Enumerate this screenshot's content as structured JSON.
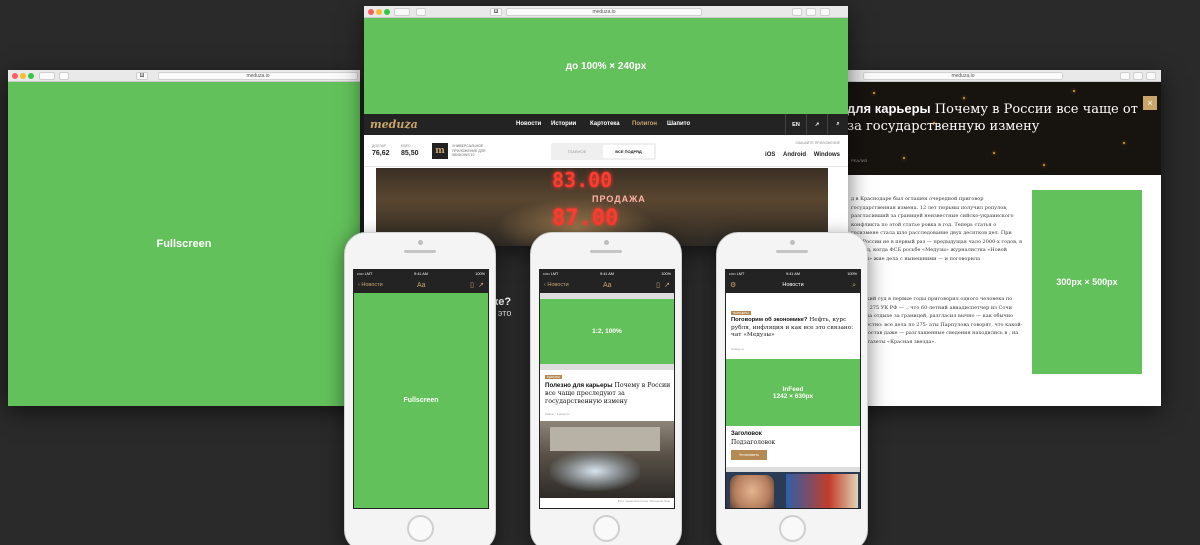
{
  "browser": {
    "url": "meduza.io",
    "tab_badge": "Ш"
  },
  "left_window": {
    "placement_label": "Fullscreen"
  },
  "center_window": {
    "top_banner_label": "до 100% × 240px",
    "logo": "meduza",
    "nav_items": [
      "Новости",
      "Истории",
      "Картотека",
      "Полигон",
      "Шапито"
    ],
    "nav_active": "Полигон",
    "lang": "EN",
    "ticker": {
      "usd_label": "Доллар",
      "usd_value": "76,62",
      "eur_label": "Евро",
      "eur_value": "85,50",
      "app_text": "Универсальное приложение для Windows 10",
      "seg_main": "Главное",
      "seg_all": "Все подряд",
      "download_label": "Скачайте приложение",
      "platforms": [
        "iOS",
        "Android",
        "Windows"
      ]
    },
    "photo_led_1": "83.00",
    "photo_sign": "ПРОДАЖА",
    "photo_led_2": "87.00",
    "photo_fragment_1": "ике?",
    "photo_fragment_2": "уе это"
  },
  "right_window": {
    "hero_title_bold": "для карьеры",
    "hero_title_rest": "Почему в России все чаще от за государственную измену",
    "hero_meta": "РЕАЛИЗ",
    "close": "×",
    "paragraph_1": "д в Краснодаре был оглашен очередной приговор государственная измена. 12 лет тюрьмы получил ропулов, разгласивший за границей неизвестные сийско-украинского конфликта по этой статье ровка в год. Теперь статья о госизмене стала шло расследование двух десятков дел. При ыла России не в первый раз — предыдущая чало 2000-х годов, в период, когда ФСБ росьбе «Медузы» журналистка «Новой газеты» жие дела с нынешними — и поговорила",
    "paragraph_2": "ндарский суд в первые годы приговорил одного человека по статье 275 УК РФ — ., что 60-летний авиадиспетчер из Сочи Петр на отдыхе за границей, разгласил вычно — как обычно неизвестно: все дела по 275- аты Парпулова говорят, что какой-либо состав даже — разглашенные сведения находились в , на сайте газеты «Красная звезда».",
    "ad_label": "300px × 500px"
  },
  "phones": {
    "status_left": "••••• LMT",
    "status_time": "9:41 AM",
    "status_right": "100%",
    "phone1": {
      "back": "Новости",
      "aa": "Aa",
      "placement_label": "Fullscreen"
    },
    "phone2": {
      "back": "Новости",
      "aa": "Aa",
      "ad_label": "1:2, 100%",
      "tag": "Реклама",
      "title_bold": "Полезно для карьеры",
      "title_rest": "Почему в России все чаще преследуют за государственную измену",
      "meta": "Рейсы  ·  3 минуты",
      "credit": "Фото: Анастасия Скляр / Вечерняя Лоха"
    },
    "phone3": {
      "title": "Новости",
      "tag": "Партнеры",
      "article_bold": "Поговорим об экономике?",
      "article_rest": "Нефть, курс рубля, инфляция и как все это связано: чат «Медузы»",
      "article_meta": "3 минуты",
      "ad_label_1": "InFeed",
      "ad_label_2": "1242 × 630px",
      "headline": "Заголовок",
      "subheadline": "Подзаголовок",
      "button": "Установить"
    }
  },
  "colors": {
    "ad_green": "#63c15b",
    "brand_gold": "#c9a56a",
    "nav_dark": "#232323",
    "background": "#2a2a2a"
  }
}
